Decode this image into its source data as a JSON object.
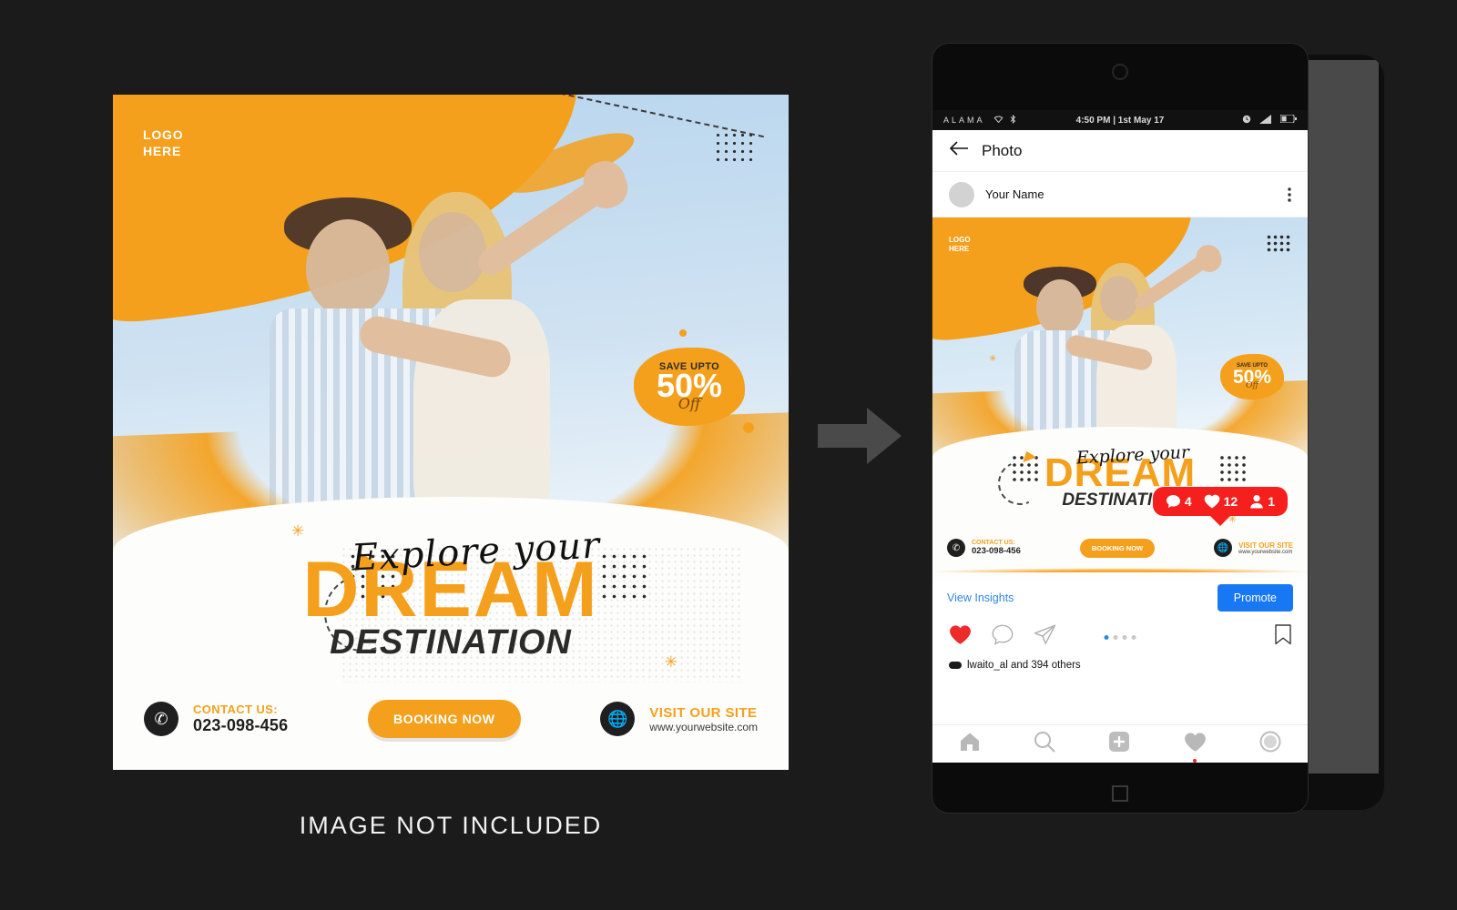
{
  "poster": {
    "logo_line1": "LOGO",
    "logo_line2": "HERE",
    "badge": {
      "save_upto": "SAVE UPTO",
      "percent": "50%",
      "off": "Off"
    },
    "headline": {
      "script": "Explore your",
      "main": "DREAM",
      "sub": "DESTINATION"
    },
    "contact": {
      "phone_icon": "phone-icon",
      "label": "CONTACT US:",
      "number": "023-098-456",
      "booking_label": "BOOKING NOW",
      "globe_icon": "globe-icon",
      "site_label": "VISIT OUR SITE",
      "site_url": "www.yourwebsite.com"
    }
  },
  "caption": "IMAGE NOT INCLUDED",
  "arrow": {
    "icon": "arrow-right-icon",
    "color": "#4a4a4a"
  },
  "phone": {
    "status": {
      "carrier": "ALAMA",
      "wifi_icon": "wifi-icon",
      "bluetooth_icon": "bluetooth-icon",
      "time": "4:50 PM | 1st May 17",
      "alarm_icon": "alarm-icon",
      "signal_icon": "signal-icon",
      "battery_icon": "battery-icon"
    },
    "header": {
      "back_icon": "back-arrow-icon",
      "title": "Photo"
    },
    "user": {
      "avatar": "avatar-placeholder",
      "name": "Your Name",
      "menu_icon": "kebab-menu-icon"
    },
    "insights": {
      "link": "View Insights",
      "promote": "Promote",
      "promote_color": "#1877f2"
    },
    "actions": {
      "like_icon": "heart-filled-icon",
      "comment_icon": "comment-icon",
      "share_icon": "send-icon",
      "bookmark_icon": "bookmark-icon"
    },
    "notification": {
      "comments": "4",
      "likes": "12",
      "followers": "1",
      "color": "#f5201d"
    },
    "likes_text": "lwaito_al  and 394 others",
    "tabs": [
      {
        "name": "home",
        "icon": "home-icon"
      },
      {
        "name": "search",
        "icon": "search-icon"
      },
      {
        "name": "add",
        "icon": "plus-square-icon"
      },
      {
        "name": "activity",
        "icon": "heart-icon"
      },
      {
        "name": "profile",
        "icon": "profile-icon"
      }
    ]
  },
  "colors": {
    "accent": "#f5a01c",
    "dark": "#2b2b2b",
    "blue": "#1877f2",
    "red": "#f5201d",
    "bg": "#1b1b1b"
  }
}
